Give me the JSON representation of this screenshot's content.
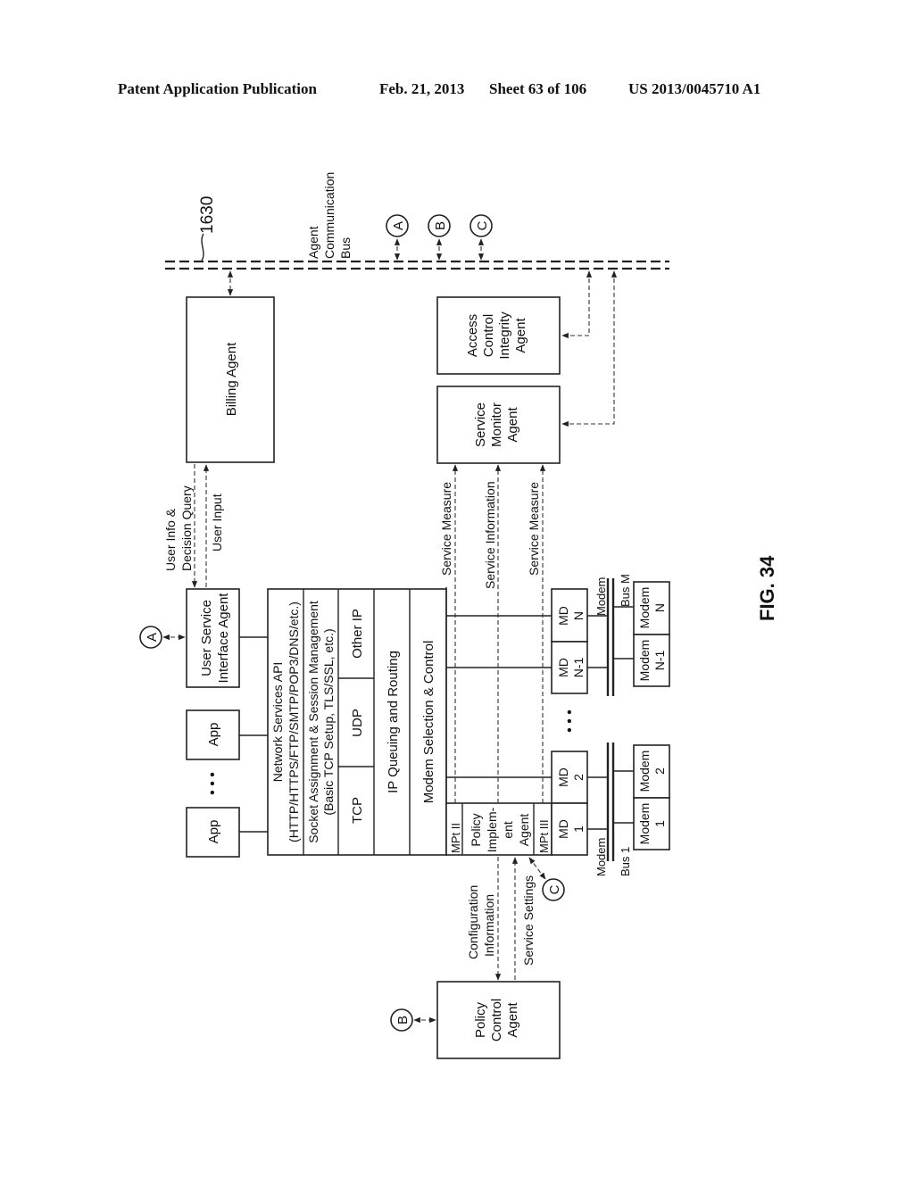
{
  "header": {
    "publication": "Patent Application Publication",
    "date": "Feb. 21, 2013",
    "sheet": "Sheet 63 of 106",
    "patent_number": "US 2013/0045710 A1"
  },
  "figure": {
    "label": "FIG. 34",
    "reference_number": "1630",
    "bus_label": [
      "Agent",
      "Communication",
      "Bus"
    ],
    "connectors": {
      "a": "A",
      "b": "B",
      "c": "C"
    },
    "billing_agent": "Billing Agent",
    "access_control_agent": [
      "Access",
      "Control",
      "Integrity",
      "Agent"
    ],
    "service_monitor_agent": [
      "Service",
      "Monitor",
      "Agent"
    ],
    "policy_control_agent": [
      "Policy",
      "Control",
      "Agent"
    ],
    "user_service_interface_agent": [
      "User Service",
      "Interface Agent"
    ],
    "apps": [
      "App",
      "App"
    ],
    "ellipsis": "• • •",
    "flow_labels": {
      "user_info": [
        "User Info &",
        "Decision Query"
      ],
      "user_input": "User Input",
      "service_measure_1": "Service Measure",
      "service_information": "Service Information",
      "service_measure_2": "Service Measure",
      "configuration_information": [
        "Configuration",
        "Information"
      ],
      "service_settings": "Service Settings"
    },
    "stack": {
      "network_services_api": [
        "Network Services API",
        "(HTTP/HTTPS/FTP/SMTP/POP3/DNS/etc.)"
      ],
      "socket_assignment": [
        "Socket Assignment & Session Management",
        "(Basic TCP Setup, TLS/SSL, etc.)"
      ],
      "tcp": "TCP",
      "udp": "UDP",
      "other_ip": "Other IP",
      "ip_queuing": "IP Queuing and Routing",
      "modem_selection": "Modem Selection & Control",
      "mpt_ii": "MPt II",
      "policy_implement_agent": [
        "Policy",
        "Implem-",
        "ent",
        "Agent"
      ],
      "mpt_iii": "MPt III"
    },
    "modem_drivers": [
      [
        "MD",
        "1"
      ],
      [
        "MD",
        "2"
      ],
      [
        "MD",
        "N-1"
      ],
      [
        "MD",
        "N"
      ]
    ],
    "modems": [
      [
        "Modem",
        "1"
      ],
      [
        "Modem",
        "2"
      ],
      [
        "Modem",
        "N-1"
      ],
      [
        "Modem",
        "N"
      ]
    ],
    "modem_bus_1": [
      "Modem",
      "Bus 1"
    ],
    "modem_bus_m": [
      "Modem",
      "Bus M"
    ]
  }
}
